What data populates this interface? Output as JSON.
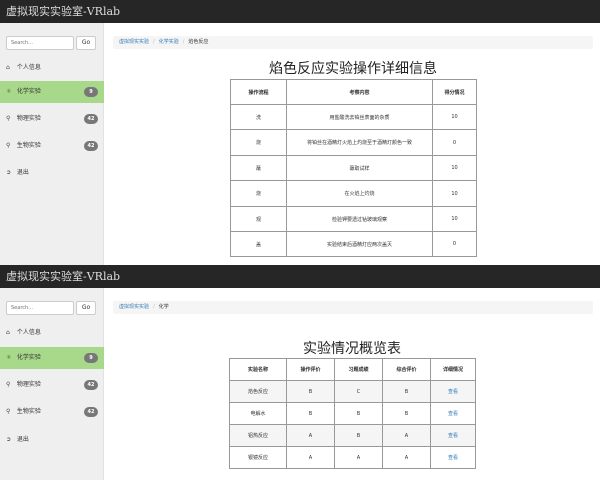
{
  "app_title": "虚拟现实实验室-VRlab",
  "search": {
    "placeholder": "Search...",
    "button": "Go"
  },
  "panel1": {
    "sidebar": [
      {
        "icon": "home",
        "label": "个人信息",
        "badge": ""
      },
      {
        "icon": "flask",
        "label": "化学实验",
        "badge": "9"
      },
      {
        "icon": "pin",
        "label": "物理实验",
        "badge": "42"
      },
      {
        "icon": "pin",
        "label": "生物实验",
        "badge": "42"
      },
      {
        "icon": "logout",
        "label": "退出",
        "badge": ""
      }
    ],
    "breadcrumb": [
      "虚拟现实实验",
      "化学实验",
      "焰色反应"
    ],
    "title": "焰色反应实验操作详细信息",
    "table": {
      "headers": [
        "操作流程",
        "考察内容",
        "得分情况"
      ],
      "rows": [
        [
          "洗",
          "用盐酸洗去铂丝表面的杂质",
          "10"
        ],
        [
          "烧",
          "将铂丝在酒精灯火焰上灼烧至于酒精灯颜色一致",
          "0"
        ],
        [
          "蘸",
          "蘸取试样",
          "10"
        ],
        [
          "烧",
          "在火焰上灼烧",
          "10"
        ],
        [
          "观",
          "检验钾要透过钴玻璃观察",
          "10"
        ],
        [
          "盖",
          "实验结束后酒精灯应两次盖灭",
          "0"
        ]
      ]
    }
  },
  "panel2": {
    "sidebar": [
      {
        "icon": "home",
        "label": "个人信息",
        "badge": ""
      },
      {
        "icon": "flask",
        "label": "化学实验",
        "badge": "9"
      },
      {
        "icon": "pin",
        "label": "物理实验",
        "badge": "42"
      },
      {
        "icon": "pin",
        "label": "生物实验",
        "badge": "42"
      },
      {
        "icon": "logout",
        "label": "退出",
        "badge": ""
      }
    ],
    "breadcrumb": [
      "虚拟现实实验",
      "化学"
    ],
    "title": "实验情况概览表",
    "table": {
      "headers": [
        "实验名称",
        "操作评价",
        "习题成绩",
        "综合评价",
        "详细情况"
      ],
      "rows": [
        [
          "焰色反应",
          "B",
          "C",
          "B",
          "查看"
        ],
        [
          "电解水",
          "B",
          "B",
          "B",
          "查看"
        ],
        [
          "铝热反应",
          "A",
          "B",
          "A",
          "查看"
        ],
        [
          "银镜反应",
          "A",
          "A",
          "A",
          "查看"
        ]
      ]
    }
  }
}
